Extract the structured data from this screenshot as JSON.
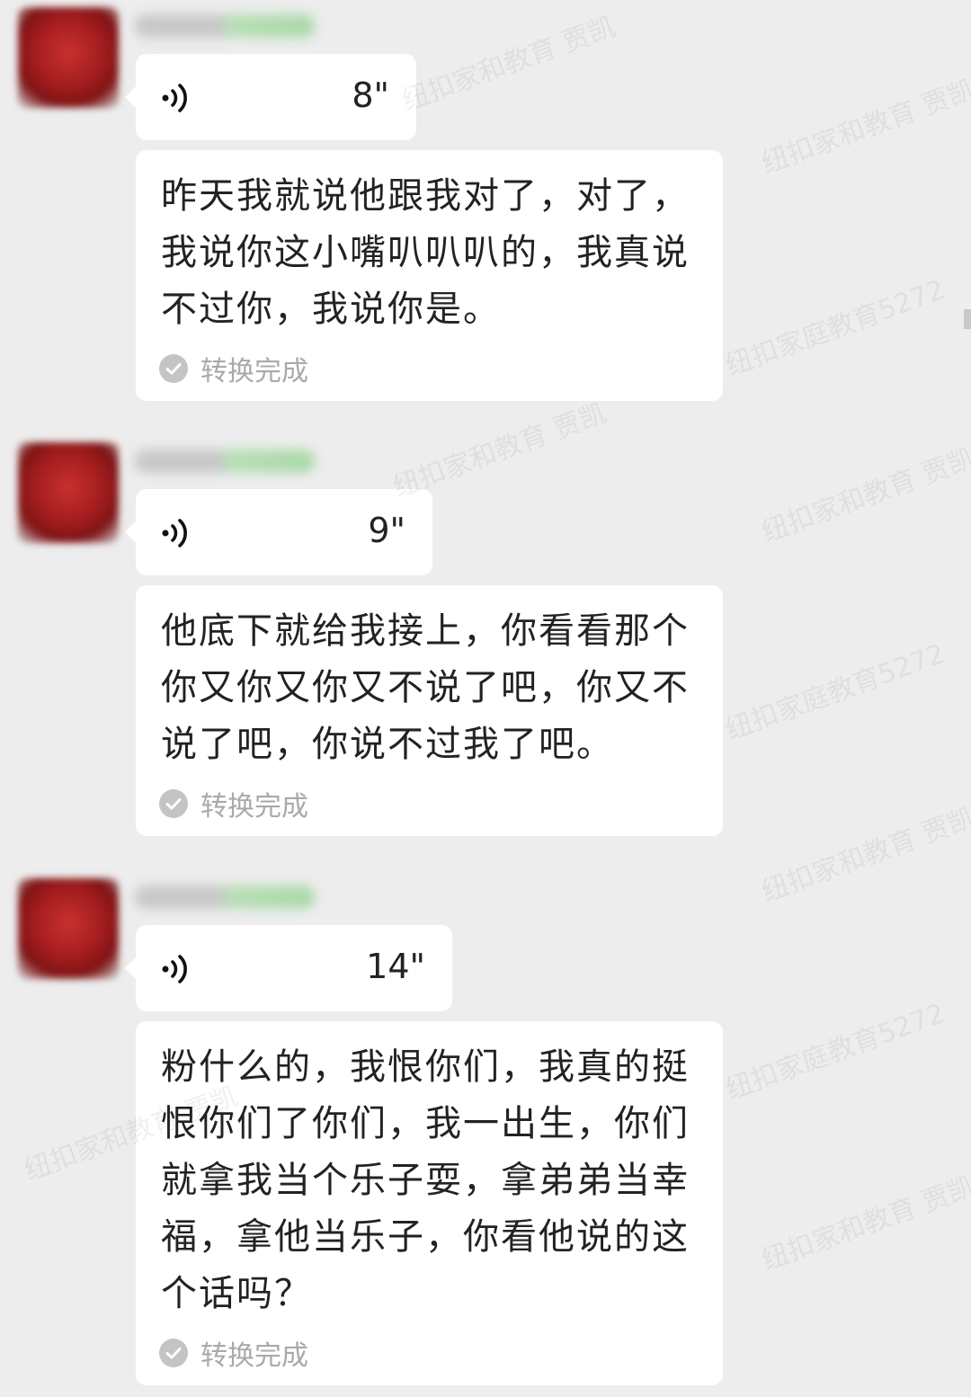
{
  "messages": [
    {
      "voice": {
        "duration": "8\""
      },
      "transcript": {
        "lines": [
          "昨天我就说他跟我对了，对了，",
          "我说你这小嘴叭叭叭的，我真说",
          "不过你，我说你是。"
        ],
        "status": "转换完成"
      }
    },
    {
      "voice": {
        "duration": "9\""
      },
      "transcript": {
        "lines": [
          "他底下就给我接上，你看看那个",
          "你又你又你又不说了吧，你又不",
          "说了吧，你说不过我了吧。"
        ],
        "status": "转换完成"
      }
    },
    {
      "voice": {
        "duration": "14\""
      },
      "transcript": {
        "lines": [
          "粉什么的，我恨你们，我真的挺",
          "恨你们了你们，我一出生，你们",
          "就拿我当个乐子耍，拿弟弟当幸",
          "福，拿他当乐子，你看他说的这",
          "个话吗？"
        ],
        "status": "转换完成"
      }
    }
  ],
  "watermarks": [
    "纽扣家和教育 贾凯",
    "纽扣家庭教育5272"
  ],
  "colors": {
    "background": "#ededed",
    "bubble": "#ffffff",
    "status_gray": "#a9a9a9",
    "avatar_red": "#a41d1e"
  },
  "icons": {
    "voice": "voice-wave-icon",
    "status": "check-circle-icon"
  }
}
